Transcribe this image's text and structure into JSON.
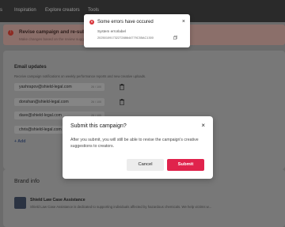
{
  "nav": {
    "items": [
      {
        "label": "s"
      },
      {
        "label": "Inspiration"
      },
      {
        "label": "Explore creators"
      },
      {
        "label": "Tools"
      }
    ]
  },
  "banner": {
    "title": "Revise campaign and re-submit fo",
    "subtitle": "Make changes based on the review sugg"
  },
  "email": {
    "title": "Email updates",
    "description": "Receive campaign notifications on weekly performance reports and new creative uploads.",
    "rows": [
      {
        "value": "yashrapov@shield-legal.com",
        "count": "26 / 100"
      },
      {
        "value": "donshan@shield-legal.com",
        "count": "26 / 100"
      },
      {
        "value": "dave@shield-legal.com",
        "count": "26 / 100"
      },
      {
        "value": "chris@shield-legal.com",
        "count": "26 / 100"
      }
    ],
    "add_label": "+ Add"
  },
  "brand": {
    "title": "Brand info",
    "name": "Shield Law Case Assistance",
    "description": "Shield Law Case Assistance is dedicated to supporting individuals affected by hazardous chemicals. We help victims w..."
  },
  "modal": {
    "title": "Submit this campaign?",
    "body": "After you submit, you will still be able to revise the campaign's creative suggestions to creators.",
    "cancel_label": "Cancel",
    "submit_label": "Submit",
    "close_glyph": "×"
  },
  "toast": {
    "title": "Some errors have occured",
    "label": "System errorlabel",
    "code": "20250109173227288644779C55AC1300",
    "close_glyph": "×",
    "icon_glyph": "×"
  },
  "colors": {
    "submit": "#e0234c",
    "error": "#d8343a",
    "overlay": "#6b6b6b"
  }
}
